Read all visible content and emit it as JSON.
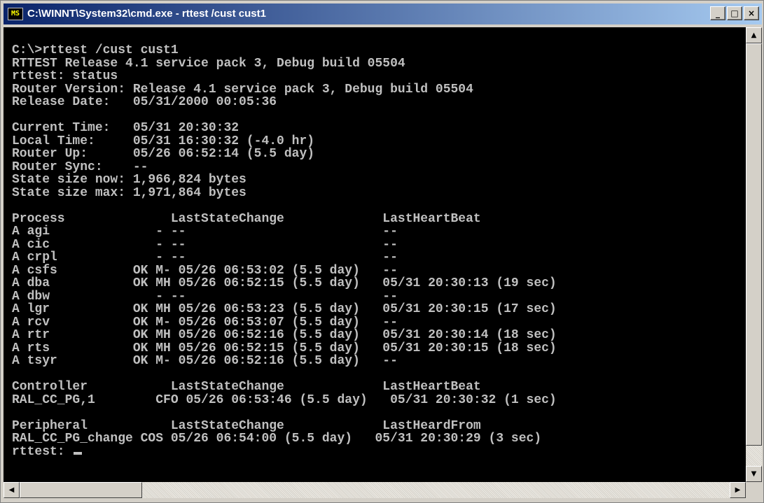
{
  "window": {
    "title": "C:\\WINNT\\System32\\cmd.exe - rttest /cust cust1",
    "icon_label": "MS",
    "controls": {
      "minimize": "_",
      "maximize": "□",
      "close": "×"
    }
  },
  "console": {
    "lines": [
      "C:\\>rttest /cust cust1",
      "RTTEST Release 4.1 service pack 3, Debug build 05504",
      "rttest: status",
      "Router Version: Release 4.1 service pack 3, Debug build 05504",
      "Release Date:   05/31/2000 00:05:36",
      "",
      "Current Time:   05/31 20:30:32",
      "Local Time:     05/31 16:30:32 (-4.0 hr)",
      "Router Up:      05/26 06:52:14 (5.5 day)",
      "Router Sync:    --",
      "State size now: 1,966,824 bytes",
      "State size max: 1,971,864 bytes",
      "",
      "Process              LastStateChange             LastHeartBeat",
      "A agi              - --                          --",
      "A cic              - --                          --",
      "A crpl             - --                          --",
      "A csfs          OK M- 05/26 06:53:02 (5.5 day)   --",
      "A dba           OK MH 05/26 06:52:15 (5.5 day)   05/31 20:30:13 (19 sec)",
      "A dbw              - --                          --",
      "A lgr           OK MH 05/26 06:53:23 (5.5 day)   05/31 20:30:15 (17 sec)",
      "A rcv           OK M- 05/26 06:53:07 (5.5 day)   --",
      "A rtr           OK MH 05/26 06:52:16 (5.5 day)   05/31 20:30:14 (18 sec)",
      "A rts           OK MH 05/26 06:52:15 (5.5 day)   05/31 20:30:15 (18 sec)",
      "A tsyr          OK M- 05/26 06:52:16 (5.5 day)   --",
      "",
      "Controller           LastStateChange             LastHeartBeat",
      "RAL_CC_PG,1        CFO 05/26 06:53:46 (5.5 day)   05/31 20:30:32 (1 sec)",
      "",
      "Peripheral           LastStateChange             LastHeardFrom",
      "RAL_CC_PG_change COS 05/26 06:54:00 (5.5 day)   05/31 20:30:29 (3 sec)"
    ],
    "prompt": "rttest: "
  },
  "scrollbars": {
    "up": "▲",
    "down": "▼",
    "left": "◀",
    "right": "▶"
  }
}
